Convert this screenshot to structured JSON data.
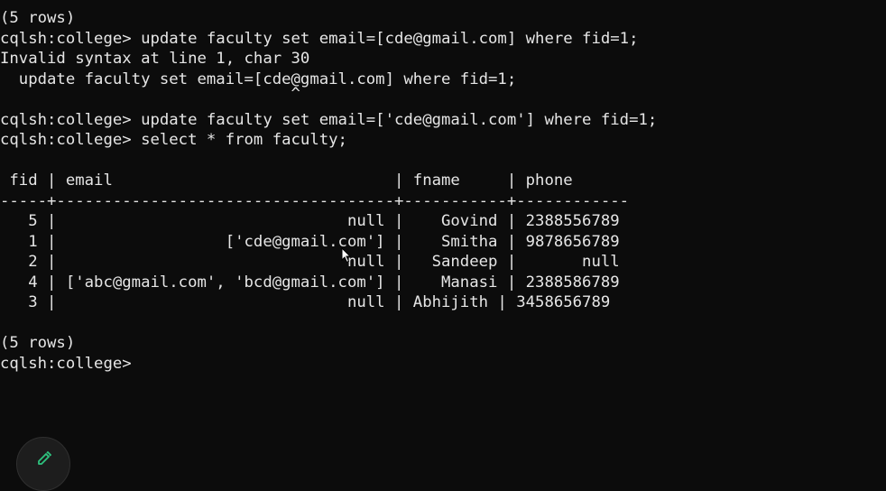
{
  "terminal": {
    "lines": [
      "(5 rows)",
      "cqlsh:college> update faculty set email=[cde@gmail.com] where fid=1;",
      "Invalid syntax at line 1, char 30",
      "  update faculty set email=[cde@gmail.com] where fid=1;",
      "                               ^",
      "cqlsh:college> update faculty set email=['cde@gmail.com'] where fid=1;",
      "cqlsh:college> select * from faculty;",
      "",
      " fid | email                              | fname     | phone",
      "-----+------------------------------------+-----------+------------",
      "   5 |                               null |    Govind | 2388556789",
      "   1 |                  ['cde@gmail.com'] |    Smitha | 9878656789",
      "   2 |                               null |   Sandeep |       null",
      "   4 | ['abc@gmail.com', 'bcd@gmail.com'] |    Manasi | 2388586789",
      "   3 |                               null | Abhijith | 3458656789",
      "",
      "(5 rows)",
      "cqlsh:college> "
    ]
  },
  "fab": {
    "icon": "pencil-icon",
    "color": "#2ec27e"
  }
}
